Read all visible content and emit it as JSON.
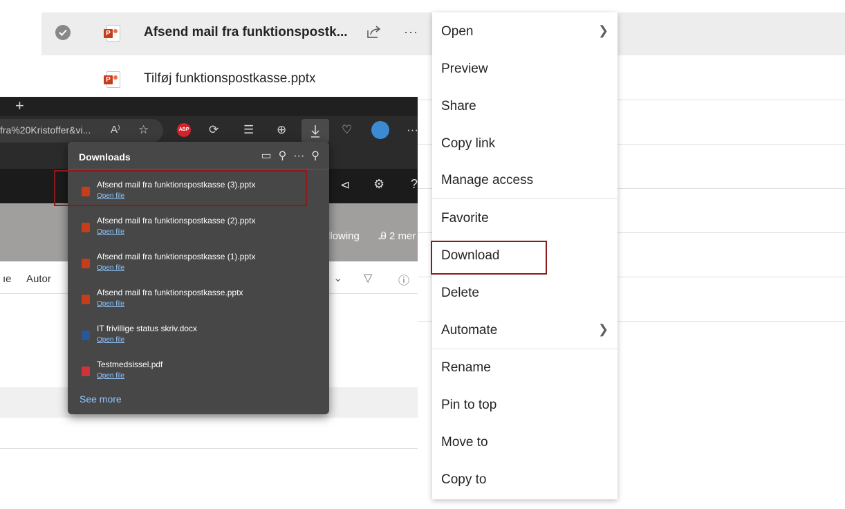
{
  "file_list": {
    "rows": [
      {
        "name": "Afsend mail fra funktionspostk...",
        "selected": true
      },
      {
        "name": "Tilføj funktionspostkasse.pptx",
        "selected": false
      }
    ],
    "more_label": "···"
  },
  "browser": {
    "new_tab": "+",
    "address_fragment": "fra%20Kristoffer&vi...",
    "read_aloud": "A⁾",
    "abp_label": "ABP",
    "overflow": "···"
  },
  "site": {
    "following": "llowing",
    "members": "Ꭿ 2 mer",
    "cmd_partial": "ıe",
    "cmd_automate": "Autor"
  },
  "downloads": {
    "title": "Downloads",
    "items": [
      {
        "name": "Afsend mail fra funktionspostkasse (3).pptx",
        "action": "Open file",
        "type": "pptx"
      },
      {
        "name": "Afsend mail fra funktionspostkasse (2).pptx",
        "action": "Open file",
        "type": "pptx"
      },
      {
        "name": "Afsend mail fra funktionspostkasse (1).pptx",
        "action": "Open file",
        "type": "pptx"
      },
      {
        "name": "Afsend mail fra funktionspostkasse.pptx",
        "action": "Open file",
        "type": "pptx"
      },
      {
        "name": "IT frivillige status skriv.docx",
        "action": "Open file",
        "type": "docx"
      },
      {
        "name": "Testmedsissel.pdf",
        "action": "Open file",
        "type": "pdf"
      }
    ],
    "see_more": "See more"
  },
  "context_menu": {
    "items": [
      {
        "label": "Open",
        "submenu": true
      },
      {
        "label": "Preview"
      },
      {
        "label": "Share"
      },
      {
        "label": "Copy link"
      },
      {
        "label": "Manage access"
      },
      {
        "label": "Favorite"
      },
      {
        "label": "Download"
      },
      {
        "label": "Delete"
      },
      {
        "label": "Automate",
        "submenu": true
      },
      {
        "label": "Rename"
      },
      {
        "label": "Pin to top"
      },
      {
        "label": "Move to"
      },
      {
        "label": "Copy to"
      }
    ]
  },
  "colors": {
    "highlight_box": "#8b1a1a",
    "ppt_red": "#c43e1c",
    "link_blue": "#8ec8ff"
  }
}
